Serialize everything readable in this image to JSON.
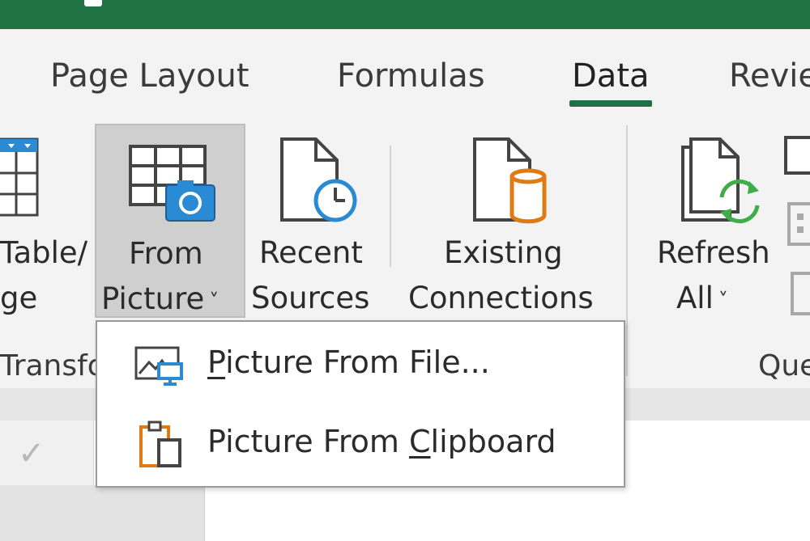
{
  "tabs": {
    "page_layout": "Page Layout",
    "formulas": "Formulas",
    "data": "Data",
    "review": "Revie"
  },
  "ribbon": {
    "from_table": {
      "line1": "Table/",
      "line2": "ge"
    },
    "from_picture": {
      "line1": "From",
      "line2": "Picture",
      "chevron": "˅"
    },
    "recent_sources": {
      "line1": "Recent",
      "line2": "Sources"
    },
    "existing_connections": {
      "line1": "Existing",
      "line2": "Connections"
    },
    "refresh_all": {
      "line1": "Refresh",
      "line2": "All",
      "chevron": "˅"
    },
    "group_transform": "Transfo",
    "group_queries": "Que"
  },
  "menu": {
    "picture_from_file": {
      "prefix": "",
      "accel": "P",
      "rest": "icture From File..."
    },
    "picture_from_clipboard": {
      "prefix": "Picture From ",
      "accel": "C",
      "rest": "lipboard"
    }
  },
  "icons": {
    "table": "table-icon",
    "from_picture": "table-camera-icon",
    "recent_sources": "document-clock-icon",
    "existing_connections": "document-database-icon",
    "refresh_all": "document-refresh-icon",
    "picture_from_file": "picture-monitor-icon",
    "picture_from_clipboard": "clipboard-icon"
  },
  "colors": {
    "excel_green": "#217346",
    "accent_blue": "#2a8ad4",
    "accent_orange": "#e07a12",
    "refresh_green": "#3fae49"
  }
}
